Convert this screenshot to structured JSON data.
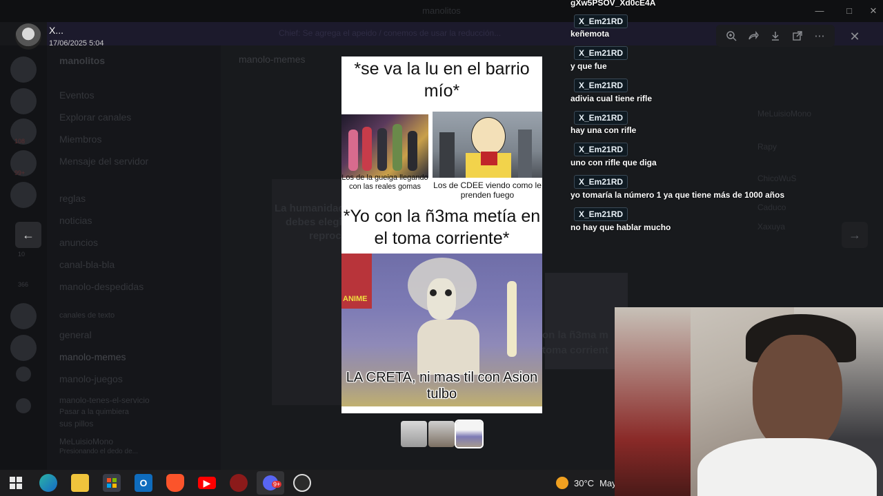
{
  "viewer": {
    "uploader": "X...",
    "timestamp": "17/06/2025 5:04"
  },
  "background": {
    "window_title": "manolitos",
    "banner": "Chief: Se agrega el apeido / conemos de usar la reducción...",
    "server_name": "manolitos",
    "channel_title": "manolo-memes",
    "server_badges": [
      "108",
      "99+",
      "10",
      "366"
    ],
    "channels": [
      "Eventos",
      "Explorar canales",
      "Miembros",
      "Mensaje del servidor",
      "reglas",
      "noticias",
      "anuncios",
      "canal-bla-bla",
      "manolo-despedidas",
      "CANALES DE TEXTO",
      "general",
      "manolo-memes",
      "manolo-juegos",
      "manolo-tenes-el-servicio",
      "Pasar a la quimbiera",
      "sus pillos"
    ],
    "user_name": "MeLuisioMono",
    "user_status": "Presionando el dedo de...",
    "ghost_left_text": [
      "La humanidad",
      "debes elegi",
      "reproc"
    ],
    "ghost_right_text": [
      "on la ñ3ma m",
      "toma corrient"
    ],
    "ghost_list": [
      "MeLuisioMono",
      "Rapy",
      "ChicoWuS",
      "Caduco",
      "Xaxuya"
    ]
  },
  "toolbar": {
    "zoom": "zoom-in-icon",
    "forward": "forward-icon",
    "download": "download-icon",
    "open": "open-external-icon",
    "more": "more-icon",
    "close": "close-icon"
  },
  "meme": {
    "caption_top": "*se va la lu en el barrio mío*",
    "panel_left_label": "Los de la gueiga llegando con las reales gomas",
    "panel_right_label": "Los de CDEE viendo como le prenden fuego",
    "caption_middle": "*Yo con la ñ3ma metía en el toma corriente*",
    "bottom_caption": "LA CRETA, ni mas til con Asion tulbo",
    "sticker_text": "ANIME"
  },
  "chat": [
    {
      "text": "gXw5PSOV_Xd0cE4A"
    },
    {
      "name": "X_Em21RD",
      "text": "keñemota"
    },
    {
      "name": "X_Em21RD",
      "text": "y que fue"
    },
    {
      "name": "X_Em21RD",
      "text": "adivia cual tiene rifle"
    },
    {
      "name": "X_Em21RD",
      "text": "hay una con rifle"
    },
    {
      "name": "X_Em21RD",
      "text": "uno con rifle que diga"
    },
    {
      "name": "X_Em21RD",
      "text": "yo tomaría la número 1 ya que tiene más de 1000 años"
    },
    {
      "name": "X_Em21RD",
      "text": "no hay que hablar mucho"
    }
  ],
  "taskbar": {
    "apps": [
      "start-icon",
      "edge-icon",
      "explorer-icon",
      "store-icon",
      "outlook-icon",
      "brave-icon",
      "youtube-icon",
      "app-icon",
      "discord-icon",
      "obs-icon"
    ],
    "discord_badge": "9+",
    "weather_temp": "30°C",
    "weather_cond": "May"
  },
  "colors": {
    "chat_name_bg": "#0f1a22",
    "chat_name_border": "#3b4a57",
    "taskbar": "#1d1d1f",
    "viewer_bg": "#0d0e10"
  }
}
